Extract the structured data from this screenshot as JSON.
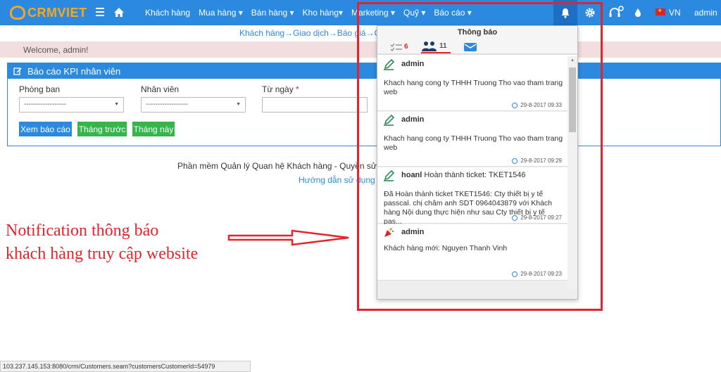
{
  "brand": {
    "logo_text": "CRMVIET",
    "primary_color": "#2b8ae0",
    "logo_color": "#f5a623"
  },
  "topnav": {
    "menu": [
      "Khách hàng",
      "Mua hàng ▾",
      "Bán hàng ▾",
      "Kho hàng▾",
      "Marketing ▾",
      "Quỹ ▾",
      "Báo cáo ▾"
    ],
    "lang": "VN",
    "user": "admin"
  },
  "breadcrumb": "Khách hàng→Giao dịch→Báo giá→Cơ h",
  "welcome": "Welcome, admin!",
  "report": {
    "title": "Báo cáo KPI nhân viên",
    "dept_label": "Phòng ban",
    "staff_label": "Nhân viên",
    "from_label": "Từ ngày",
    "required_mark": "*",
    "dept_value": "------------------",
    "staff_value": "------------------",
    "btn_view": "Xem báo cáo",
    "btn_prev": "Tháng trước",
    "btn_this": "Tháng này"
  },
  "footer": {
    "line1": "Phần mềm Quản lý Quan hệ Khách hàng - Quyền sử dụng",
    "line2": "Hướng dẫn sử dụng - "
  },
  "annotation": {
    "line1": "Notification thông báo",
    "line2": "khách hàng truy cập website"
  },
  "notifications": {
    "title": "Thông báo",
    "tabs": [
      {
        "icon": "tasks-icon",
        "count": "6"
      },
      {
        "icon": "users-icon",
        "count": "11"
      },
      {
        "icon": "mail-icon",
        "count": ""
      }
    ],
    "items": [
      {
        "author": "admin",
        "subject": "",
        "body": "Khach hang cong ty THHH Truong Tho vao tham trang web",
        "time": "29-8-2017 09:33",
        "icon": "edit-icon"
      },
      {
        "author": "admin",
        "subject": "",
        "body": "Khach hang cong ty THHH Truong Tho vao tham trang web",
        "time": "29-8-2017 09:29",
        "icon": "edit-icon"
      },
      {
        "author": "hoanl",
        "subject": "Hoàn thành ticket: TKET1546",
        "body": "Đã Hoàn thành ticket TKET1546: Cty thiết bị y tế passcal. chị châm anh SDT 0964043879 với Khách hàng Nội dung thực hiện như sau Cty thiết bị y tế pas...",
        "time": "29-8-2017 09:27",
        "icon": "edit-icon"
      },
      {
        "author": "admin",
        "subject": "",
        "body": "Khách hàng mới: Nguyen Thanh Vinh",
        "time": "29-8-2017 09:23",
        "icon": "new-customer-icon"
      }
    ]
  },
  "statusbar": "103.237.145.153:8080/crm/Customers.seam?customersCustomerId=54979"
}
